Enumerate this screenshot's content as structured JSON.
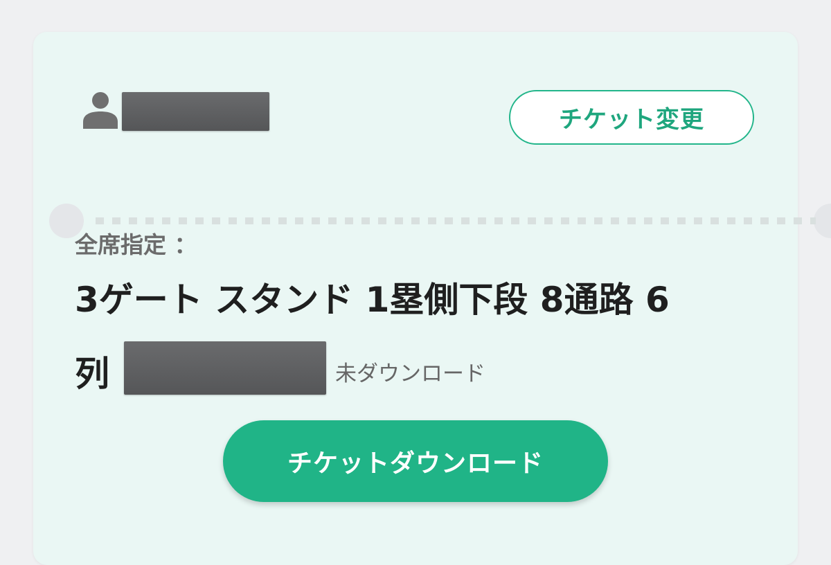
{
  "ticket": {
    "change_button_label": "チケット変更",
    "seat_type_label": "全席指定 ：",
    "seat_line1": "3ゲート スタンド 1塁側下段 8通路 6",
    "seat_line2": "列",
    "download_status": "未ダウンロード",
    "download_button_label": "チケットダウンロード"
  },
  "icons": {
    "holder": "person-icon"
  },
  "colors": {
    "accent": "#20b487",
    "card_background": "#eaf7f4",
    "page_background": "#eff0f2"
  }
}
